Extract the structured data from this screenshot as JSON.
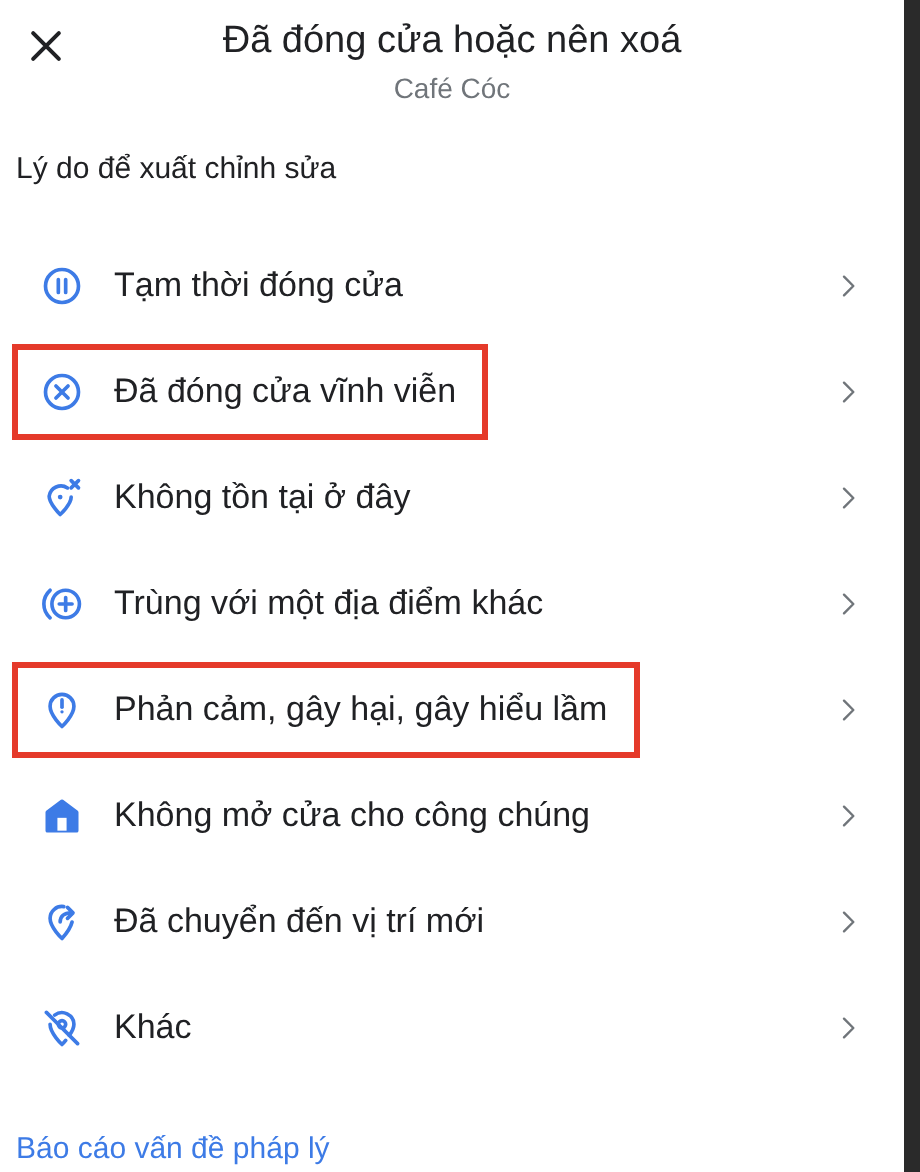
{
  "header": {
    "title": "Đã đóng cửa hoặc nên xoá",
    "subtitle": "Café Cóc"
  },
  "section_label": "Lý do để xuất chỉnh sửa",
  "reasons": [
    {
      "kind": "pause",
      "label": "Tạm thời đóng cửa",
      "highlighted": false
    },
    {
      "kind": "closed",
      "label": "Đã đóng cửa vĩnh viễn",
      "highlighted": true
    },
    {
      "kind": "not-here",
      "label": "Không tồn tại ở đây",
      "highlighted": false
    },
    {
      "kind": "duplicate",
      "label": "Trùng với một địa điểm khác",
      "highlighted": false
    },
    {
      "kind": "offensive",
      "label": "Phản cảm, gây hại, gây hiểu lầm",
      "highlighted": true
    },
    {
      "kind": "private",
      "label": "Không mở cửa cho công chúng",
      "highlighted": false
    },
    {
      "kind": "moved",
      "label": "Đã chuyển đến vị trí mới",
      "highlighted": false
    },
    {
      "kind": "other",
      "label": "Khác",
      "highlighted": false
    }
  ],
  "legal_link": "Báo cáo vấn đề pháp lý"
}
